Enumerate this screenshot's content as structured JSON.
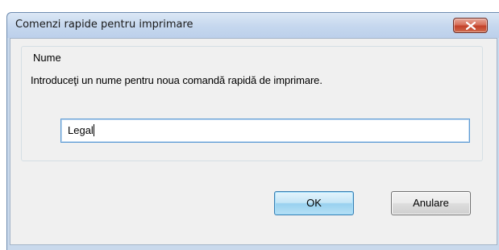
{
  "dialog": {
    "title": "Comenzi rapide pentru imprimare",
    "close_icon": "close-x-icon"
  },
  "group": {
    "legend": "Nume",
    "instruction": "Introduceţi un nume pentru noua comandă rapidă de imprimare."
  },
  "name_field": {
    "value": "Legal"
  },
  "buttons": {
    "ok_label": "OK",
    "cancel_label": "Anulare"
  },
  "colors": {
    "close_button": "#c3412a",
    "input_focus_border": "#5d9bd4",
    "default_button_border": "#3c7fb1"
  }
}
